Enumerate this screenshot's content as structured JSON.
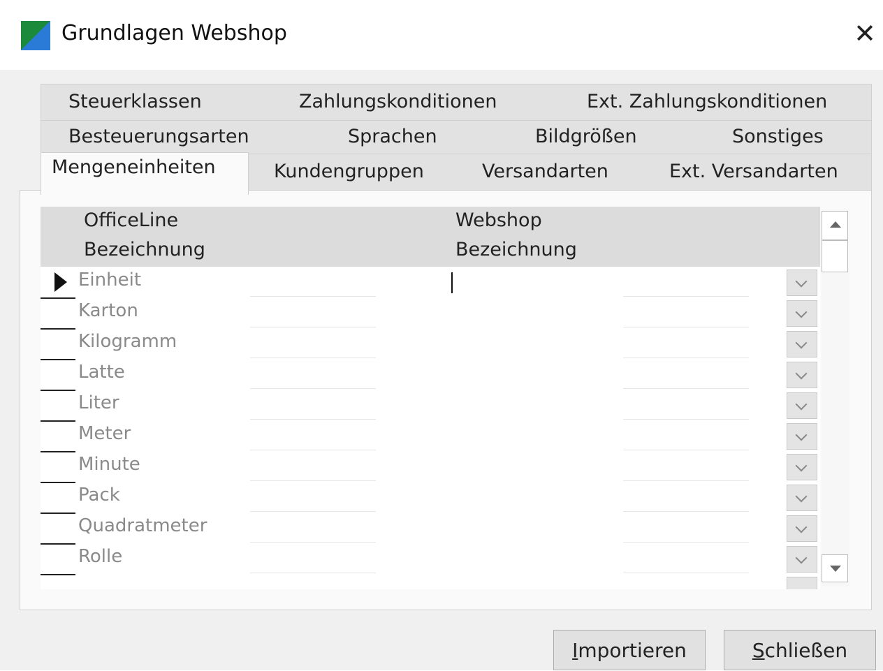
{
  "window": {
    "title": "Grundlagen Webshop",
    "icon": "app-grid-icon",
    "close_icon": "close-x-icon",
    "close_glyph": "✕"
  },
  "tabs": {
    "row1": [
      "Steuerklassen",
      "Zahlungskonditionen",
      "Ext. Zahlungskonditionen"
    ],
    "row2": [
      "Besteuerungsarten",
      "Sprachen",
      "Bildgrößen",
      "Sonstiges"
    ],
    "row3": [
      "Mengeneinheiten",
      "Kundengruppen",
      "Versandarten",
      "Ext. Versandarten"
    ],
    "active": "Mengeneinheiten"
  },
  "grid": {
    "header": {
      "col1_line1": "OfficeLine",
      "col1_line2": "Bezeichnung",
      "col2_line1": "Webshop",
      "col2_line2": "Bezeichnung"
    },
    "rows": [
      {
        "officeline": "Einheit",
        "webshop": ""
      },
      {
        "officeline": "Karton",
        "webshop": ""
      },
      {
        "officeline": "Kilogramm",
        "webshop": ""
      },
      {
        "officeline": "Latte",
        "webshop": ""
      },
      {
        "officeline": "Liter",
        "webshop": ""
      },
      {
        "officeline": "Meter",
        "webshop": ""
      },
      {
        "officeline": "Minute",
        "webshop": ""
      },
      {
        "officeline": "Pack",
        "webshop": ""
      },
      {
        "officeline": "Quadratmeter",
        "webshop": ""
      },
      {
        "officeline": "Rolle",
        "webshop": ""
      }
    ],
    "selected_row": 0
  },
  "buttons": {
    "import_mnemonic": "I",
    "import_rest": "mportieren",
    "close_mnemonic": "S",
    "close_rest": "chließen"
  },
  "colors": {
    "header_bg": "#dcdcdc",
    "tab_bg": "#e2e2e2",
    "dialog_bg": "#f0f0f0"
  }
}
